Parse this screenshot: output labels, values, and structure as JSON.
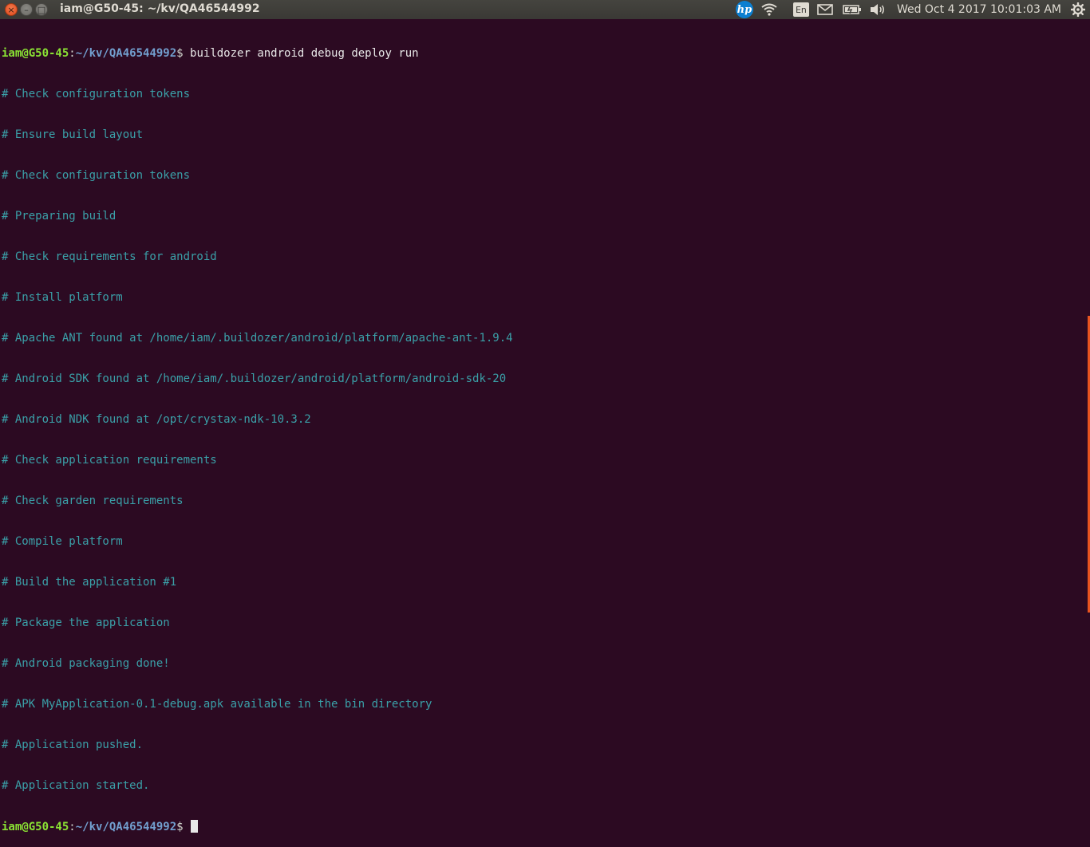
{
  "window": {
    "title": "iam@G50-45: ~/kv/QA46544992",
    "close_glyph": "×",
    "minimize_glyph": "–",
    "maximize_glyph": "□"
  },
  "indicators": {
    "hp_label": "hp",
    "language": "En",
    "clock": "Wed Oct  4 2017 10:01:03 AM",
    "icons": [
      "hp-icon",
      "wifi-icon",
      "keyboard-layout-icon",
      "mail-icon",
      "battery-icon",
      "volume-icon",
      "gear-icon"
    ]
  },
  "terminal": {
    "prompt_user": "iam@G50-45",
    "prompt_sep": ":",
    "prompt_path": "~/kv/QA46544992",
    "prompt_sym": "$",
    "command": " buildozer android debug deploy run",
    "output": [
      "# Check configuration tokens",
      "# Ensure build layout",
      "# Check configuration tokens",
      "# Preparing build",
      "# Check requirements for android",
      "# Install platform",
      "# Apache ANT found at /home/iam/.buildozer/android/platform/apache-ant-1.9.4",
      "# Android SDK found at /home/iam/.buildozer/android/platform/android-sdk-20",
      "# Android NDK found at /opt/crystax-ndk-10.3.2",
      "# Check application requirements",
      "# Check garden requirements",
      "# Compile platform",
      "# Build the application #1",
      "# Package the application",
      "# Android packaging done!",
      "# APK MyApplication-0.1-debug.apk available in the bin directory",
      "# Application pushed.",
      "# Application started."
    ]
  },
  "colors": {
    "terminal_bg": "#2c0a22",
    "output_text": "#3aa0a8",
    "prompt_user": "#8ae234",
    "prompt_path": "#729fcf",
    "accent": "#e95420"
  }
}
